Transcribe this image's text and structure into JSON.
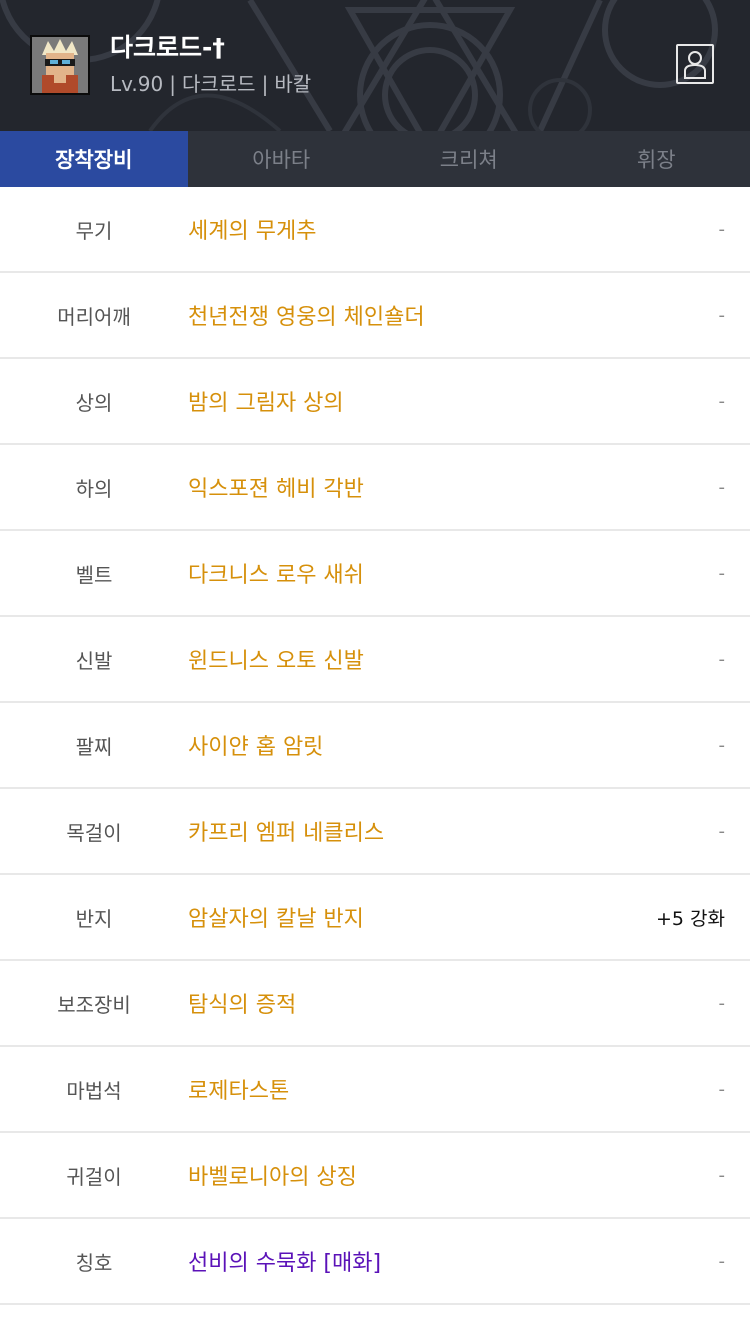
{
  "header": {
    "character_name": "다크로드-†",
    "level": "Lv.90",
    "job": "다크로드",
    "server": "바칼",
    "separator": "|",
    "avatar_icon": "character-portrait-icon",
    "profile_icon": "person-icon"
  },
  "tabs": [
    {
      "label": "장착장비",
      "active": true
    },
    {
      "label": "아바타",
      "active": false
    },
    {
      "label": "크리쳐",
      "active": false
    },
    {
      "label": "휘장",
      "active": false
    }
  ],
  "colors": {
    "accent_blue": "#2b4aa0",
    "item_gold": "#d6900b",
    "item_purple": "#5b12b8"
  },
  "equipment": [
    {
      "slot": "무기",
      "item": "세계의 무게추",
      "extra": "-",
      "rarity": "gold"
    },
    {
      "slot": "머리어깨",
      "item": "천년전쟁 영웅의 체인숄더",
      "extra": "-",
      "rarity": "gold"
    },
    {
      "slot": "상의",
      "item": "밤의 그림자 상의",
      "extra": "-",
      "rarity": "gold"
    },
    {
      "slot": "하의",
      "item": "익스포젼 헤비 각반",
      "extra": "-",
      "rarity": "gold"
    },
    {
      "slot": "벨트",
      "item": "다크니스 로우 새쉬",
      "extra": "-",
      "rarity": "gold"
    },
    {
      "slot": "신발",
      "item": "윈드니스 오토 신발",
      "extra": "-",
      "rarity": "gold"
    },
    {
      "slot": "팔찌",
      "item": "사이얀 홉 암릿",
      "extra": "-",
      "rarity": "gold"
    },
    {
      "slot": "목걸이",
      "item": "카프리 엠퍼 네클리스",
      "extra": "-",
      "rarity": "gold"
    },
    {
      "slot": "반지",
      "item": "암살자의 칼날 반지",
      "extra": "+5 강화",
      "rarity": "gold"
    },
    {
      "slot": "보조장비",
      "item": "탐식의 증적",
      "extra": "-",
      "rarity": "gold"
    },
    {
      "slot": "마법석",
      "item": "로제타스톤",
      "extra": "-",
      "rarity": "gold"
    },
    {
      "slot": "귀걸이",
      "item": "바벨로니아의 상징",
      "extra": "-",
      "rarity": "gold"
    },
    {
      "slot": "칭호",
      "item": "선비의 수묵화 [매화]",
      "extra": "-",
      "rarity": "purple"
    }
  ]
}
